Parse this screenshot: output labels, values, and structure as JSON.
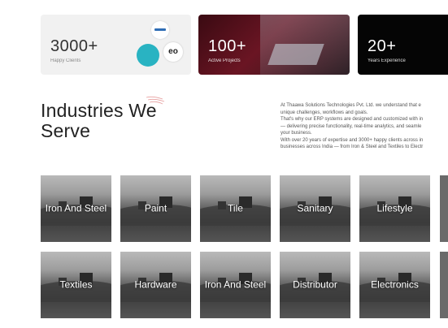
{
  "stats": [
    {
      "number": "3000+",
      "label": "Happy Clients"
    },
    {
      "number": "100+",
      "label": "Active Projects"
    },
    {
      "number": "20+",
      "label": "Years Experience"
    }
  ],
  "logo_text": "eo",
  "section": {
    "title": "Industries We Serve",
    "paragraphs": [
      "At Thaawa Solutions Technologies Pvt. Ltd. we understand that e",
      "unique challenges, workflows and goals.",
      "That's why our ERP systems are designed and customized with in",
      "— delivering precise functionality, real-time analytics, and seamle",
      "your business.",
      "With over 20 years of expertise and 3000+ happy clients across in",
      "businesses across India — from Iron & Steel and Textiles to Electr",
      ""
    ]
  },
  "industries_row1": [
    "Iron And Steel",
    "Paint",
    "Tile",
    "Sanitary",
    "Lifestyle"
  ],
  "industries_row2": [
    "Textiles",
    "Hardware",
    "Iron And Steel",
    "Distributor",
    "Electronics"
  ]
}
